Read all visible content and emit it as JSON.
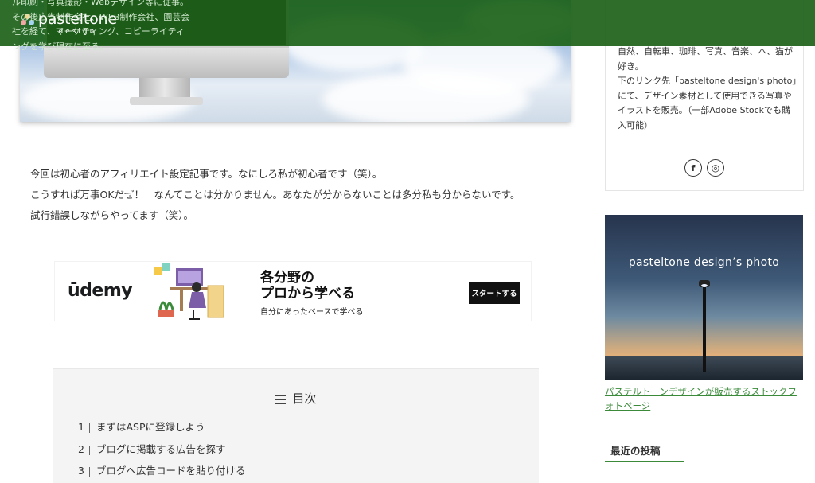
{
  "header": {
    "logo_main": "pasteltone",
    "logo_sub": "design"
  },
  "article": {
    "paragraphs": [
      "今回は初心者のアフィリエイト設定記事です。なにしろ私が初心者です（笑）。",
      "こうすれば万事OKだぜ！　なんてことは分かりません。あなたが分からないことは多分私も分からないです。",
      "試行錯誤しながらやってます（笑）。"
    ]
  },
  "ad": {
    "brand": "ūdemy",
    "title_line1": "各分野の",
    "title_line2": "プロから学べる",
    "subtitle": "自分にあったペースで学べる",
    "button": "スタートする"
  },
  "toc": {
    "title": "目次",
    "items": [
      {
        "num": "1",
        "label": "まずはASPに登録しよう"
      },
      {
        "num": "2",
        "label": "ブログに掲載する広告を探す"
      },
      {
        "num": "3",
        "label": "ブログへ広告コードを貼り付ける"
      }
    ]
  },
  "sidebar": {
    "profile_top": "ル印刷・写真撮影・Webデザイン等に従事。その後広告制作会社、WEB制作会社、園芸会社を経て、マーケティング、コピーライティングを学び現在に至る。",
    "profile_lines": [
      "自然、自転車、珈琲、写真、音楽、本、猫が好き。",
      "下のリンク先「pasteltone design's photo」にて、デザイン素材として使用できる写真やイラストを販売。（一部Adobe Stockでも購入可能）"
    ],
    "social": {
      "facebook": "f",
      "instagram": "◎"
    },
    "photo_banner_title": "pasteltone design’s photo",
    "photo_link": "パステルトーンデザインが販売するストックフォトページ",
    "recent_title": "最近の投稿"
  }
}
